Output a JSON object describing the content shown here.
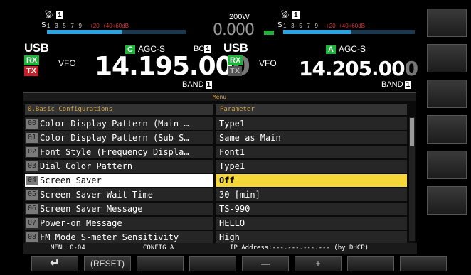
{
  "header": {
    "main": {
      "antenna": "1",
      "meter_s_label": "S",
      "meter_scale": [
        "1",
        "3",
        "5",
        "7",
        "9"
      ],
      "meter_scale_plus": [
        "+20",
        "+40",
        "+60dB"
      ],
      "mode": "USB",
      "rx": "RX",
      "tx": "TX",
      "vfo": "VFO",
      "agc_badge": "C",
      "agc": "AGC-S",
      "bc": "BC",
      "bc_num": "1",
      "freq_main": "14.195.00",
      "freq_dim": "0",
      "band": "BAND",
      "band_num": "1"
    },
    "power": "200W",
    "power_value": "0.000",
    "sub": {
      "antenna": "1",
      "meter_s_label": "S",
      "meter_scale": [
        "1",
        "3",
        "5",
        "7",
        "9"
      ],
      "meter_scale_plus": [
        "+20",
        "+40",
        "+60dB"
      ],
      "mode": "USB",
      "rx": "RX",
      "tx": "TX",
      "vfo": "VFO",
      "agc_badge": "A",
      "agc": "AGC-S",
      "freq_main": "14.205.00",
      "freq_dim": "0",
      "band": "BAND",
      "band_num": "1"
    }
  },
  "menu": {
    "title": "Menu",
    "col_left": "0.Basic Configurations",
    "col_right": "Parameter",
    "rows": [
      {
        "num": "00",
        "name": "Color Display Pattern (Main …",
        "value": "Type1",
        "selected": false
      },
      {
        "num": "01",
        "name": "Color Display Pattern (Sub S…",
        "value": "Same as Main",
        "selected": false
      },
      {
        "num": "02",
        "name": "Font Style (Frequency Displa…",
        "value": "Font1",
        "selected": false
      },
      {
        "num": "03",
        "name": "Dial Color Pattern",
        "value": "Type1",
        "selected": false
      },
      {
        "num": "04",
        "name": "Screen Saver",
        "value": "Off",
        "selected": true
      },
      {
        "num": "05",
        "name": "Screen Saver Wait Time",
        "value": "30 [min]",
        "selected": false
      },
      {
        "num": "06",
        "name": "Screen Saver Message",
        "value": "TS-990",
        "selected": false
      },
      {
        "num": "07",
        "name": "Power-on Message",
        "value": "HELLO",
        "selected": false
      },
      {
        "num": "08",
        "name": "FM Mode S-meter Sensitivity",
        "value": "High",
        "selected": false
      }
    ],
    "status": {
      "menu_no": "MENU 0-04",
      "config": "CONFIG A",
      "ip": "IP Address:---.---.---.--- (by DHCP)"
    }
  },
  "bottom_keys": {
    "back": "↵",
    "reset": "(RESET)",
    "minus": "—",
    "plus": "+"
  },
  "colors": {
    "rx_green": "#1db33b",
    "tx_red": "#c8202a",
    "selected_value": "#f5d73a",
    "header_text": "#cfa44a",
    "meter_blue": "#2aa3e0"
  }
}
